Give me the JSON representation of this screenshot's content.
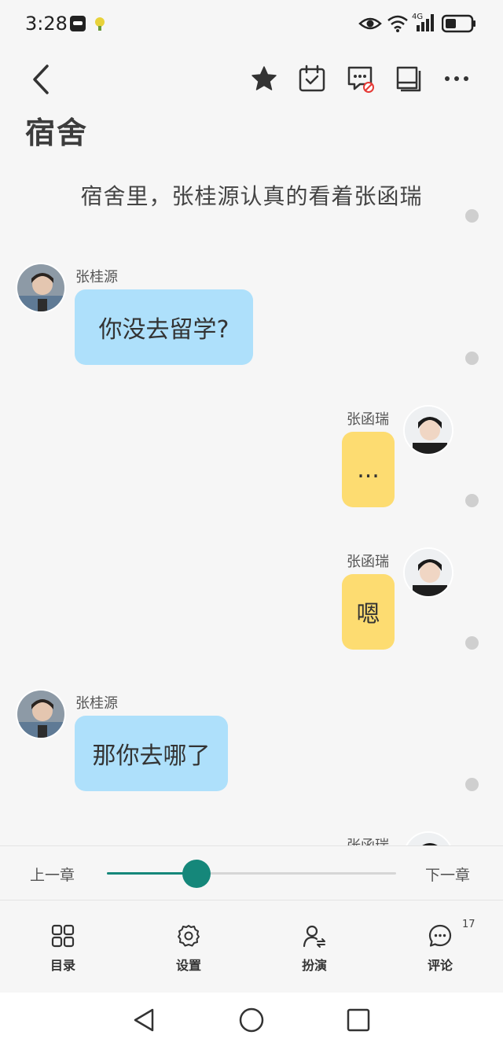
{
  "status_bar": {
    "time": "3:28"
  },
  "chapter": {
    "title": "宿舍"
  },
  "narration": "宿舍里，张桂源认真的看着张函瑞",
  "messages": [
    {
      "speaker": "张桂源",
      "text": "你没去留学?"
    },
    {
      "speaker": "张函瑞",
      "text": "..."
    },
    {
      "speaker": "张函瑞",
      "text": "嗯"
    },
    {
      "speaker": "张桂源",
      "text": "那你去哪了"
    },
    {
      "speaker": "张函瑞",
      "text": ""
    }
  ],
  "chapter_nav": {
    "prev": "上一章",
    "next": "下一章",
    "progress": 0.31
  },
  "toolbar": {
    "catalog": "目录",
    "settings": "设置",
    "roleplay": "扮演",
    "comments": "评论",
    "comment_count": "17"
  },
  "colors": {
    "accent": "#15877a",
    "bubble_left": "#aee0fb",
    "bubble_right": "#fddc71"
  },
  "icons": [
    "back-icon",
    "star-icon",
    "calendar-check-icon",
    "comment-block-icon",
    "notebook-icon",
    "more-icon",
    "grid-icon",
    "gear-icon",
    "person-swap-icon",
    "chat-bubble-icon"
  ]
}
